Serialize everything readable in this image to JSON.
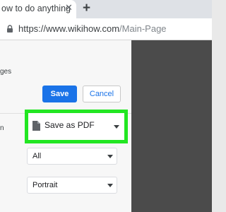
{
  "browser": {
    "tab_title": "ow to do anything",
    "close_glyph": "✕",
    "new_tab_glyph": "+",
    "url_host": "https://www.wikihow.com",
    "url_path": "/Main-Page"
  },
  "print": {
    "pages_label": "ges",
    "destination_label": "n",
    "save_label": "Save",
    "cancel_label": "Cancel",
    "destination_value": "Save as PDF",
    "pages_value": "All",
    "layout_value": "Portrait"
  },
  "colors": {
    "accent": "#1a73e8",
    "highlight": "#22e622",
    "dark_preview": "#4b4b4b"
  }
}
